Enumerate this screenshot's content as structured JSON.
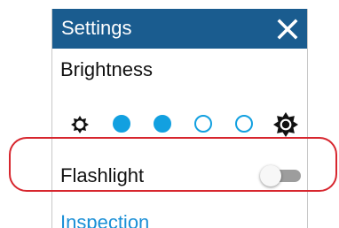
{
  "header": {
    "title": "Settings",
    "close_icon": "close-icon",
    "background_color": "#1a5c8f"
  },
  "brightness": {
    "label": "Brightness",
    "min_icon": "sun-outline-small-icon",
    "max_icon": "sun-filled-large-icon",
    "levels": [
      {
        "filled": true
      },
      {
        "filled": true
      },
      {
        "filled": false
      },
      {
        "filled": false
      }
    ],
    "current_level": 2,
    "accent_color": "#12a0e0"
  },
  "flashlight": {
    "label": "Flashlight",
    "enabled": false
  },
  "inspection": {
    "label": "Inspection",
    "color": "#1a8fd6"
  },
  "highlight": {
    "color": "#d7262e"
  }
}
